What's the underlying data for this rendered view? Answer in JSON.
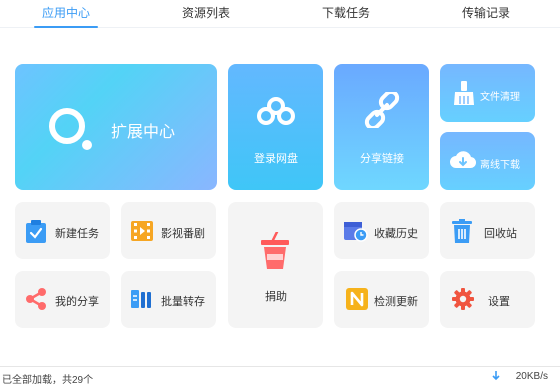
{
  "tabs": [
    {
      "label": "应用中心",
      "active": true
    },
    {
      "label": "资源列表",
      "active": false
    },
    {
      "label": "下载任务",
      "active": false
    },
    {
      "label": "传输记录",
      "active": false
    }
  ],
  "tiles": {
    "extension_center": "扩展中心",
    "login_cloud": "登录网盘",
    "share_link": "分享链接",
    "file_cleanup": "文件清理",
    "offline_download": "离线下载",
    "new_task": "新建任务",
    "video_series": "影视番剧",
    "donate": "捐助",
    "favorites_history": "收藏历史",
    "recycle_bin": "回收站",
    "my_share": "我的分享",
    "batch_transfer": "批量转存",
    "check_update": "检测更新",
    "settings": "设置"
  },
  "status": {
    "left_text": "已全部加载，共29个",
    "speed": "20KB/s"
  },
  "colors": {
    "accent": "#3b9cf5",
    "tile_grey": "#f4f4f4",
    "donate_red": "#ff5a5a",
    "share_red": "#ff6b6b",
    "settings_red": "#f0543f",
    "update_yellow": "#f6b21b"
  },
  "icons": {
    "extension": "search-ring-icon",
    "login": "cloud-icon",
    "share": "link-icon",
    "cleanup": "broom-icon",
    "offline": "cloud-download-icon",
    "new_task": "clipboard-check-icon",
    "video": "film-icon",
    "donate": "cup-icon",
    "history": "calendar-clock-icon",
    "recycle": "trash-icon",
    "my_share": "share-icon",
    "batch": "batch-transfer-icon",
    "update": "n-badge-icon",
    "settings": "gear-icon",
    "speed": "download-arrow-icon"
  }
}
